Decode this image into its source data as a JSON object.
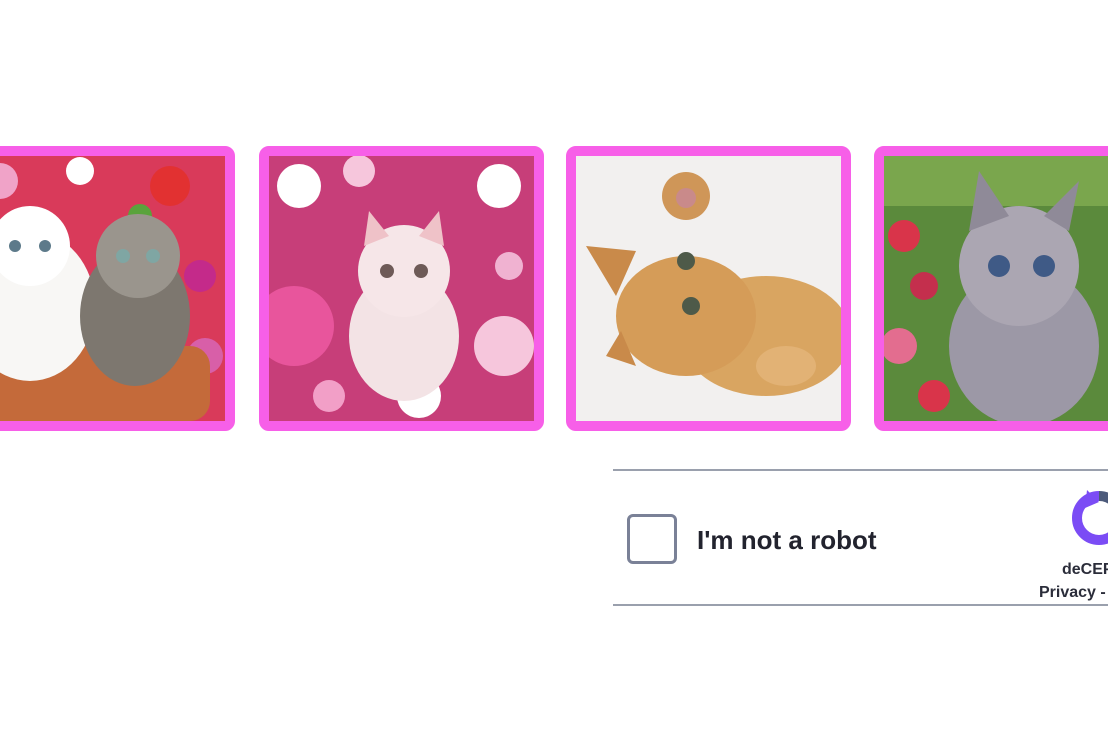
{
  "tiles": [
    {
      "subject": "two kittens in a flower pot",
      "colors": {
        "bg": "#d93a5a",
        "accent": "#f0a3c8"
      }
    },
    {
      "subject": "pink kitten among flowers",
      "colors": {
        "bg": "#c73e79",
        "accent": "#f6c6dc"
      }
    },
    {
      "subject": "ginger kitten on its back",
      "colors": {
        "bg": "#f2f0ef",
        "accent": "#d59c58"
      }
    },
    {
      "subject": "grey tabby kitten in garden",
      "colors": {
        "bg": "#5b8a3c",
        "accent": "#9c98a6"
      }
    }
  ],
  "captcha": {
    "checkbox_label": "I'm not a robot",
    "brand": "deCEP",
    "links": [
      "Privacy",
      "-"
    ],
    "logo_icon": "decaptcha-logo-icon"
  },
  "colors": {
    "tile_border": "#f75fe8",
    "captcha_border": "#9aa0ad",
    "logo_purple": "#7b4cf5"
  }
}
